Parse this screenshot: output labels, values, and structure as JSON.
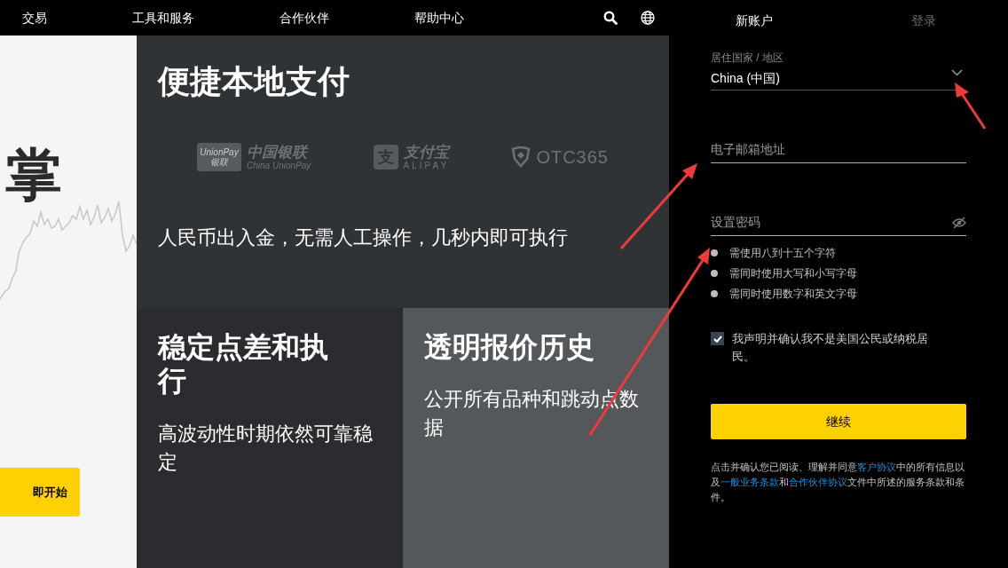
{
  "nav": {
    "items": [
      "交易",
      "工具和服务",
      "合作伙伴",
      "帮助中心"
    ]
  },
  "hero": {
    "title": "掌",
    "button": "即开始"
  },
  "cards": [
    {
      "kind": "payment",
      "title": "便捷本地支付",
      "text": "人民币出入金，无需人工操作，几秒内即可执行",
      "logos": [
        {
          "kind": "unionpay",
          "badge": "UnionPay 银联",
          "name": "中国银联",
          "sub": "China UnionPay"
        },
        {
          "kind": "alipay",
          "badge": "支",
          "name": "支付宝",
          "sub": "ALIPAY"
        },
        {
          "kind": "otc",
          "name": "OTC365"
        }
      ]
    },
    {
      "kind": "spread",
      "title": "稳定点差和执行",
      "text": "高波动性时期依然可靠稳定"
    },
    {
      "kind": "quotes",
      "title": "透明报价历史",
      "text": "公开所有品种和跳动点数据"
    }
  ],
  "signup": {
    "tabs": [
      {
        "label": "新账户",
        "selected": true
      },
      {
        "label": "登录",
        "selected": false
      }
    ],
    "country": {
      "label": "居住国家 / 地区",
      "value": "China (中国)"
    },
    "email": {
      "placeholder": "电子邮箱地址"
    },
    "password": {
      "placeholder": "设置密码"
    },
    "rules": [
      {
        "text": "需使用八到十五个字符",
        "met": false
      },
      {
        "text": "需同时使用大写和小写字母",
        "met": false
      },
      {
        "text": "需同时使用数字和英文字母",
        "met": false
      }
    ],
    "declaration": {
      "text": "我声明并确认我不是美国公民或纳税居民。",
      "checked": true
    },
    "button": "继续",
    "notice": [
      {
        "text": "点击并确认您已阅读、理解并同意",
        "link": false
      },
      {
        "text": "客户协议",
        "link": true
      },
      {
        "text": "中的所有信息以及",
        "link": false
      },
      {
        "text": "一般业务条款",
        "link": true
      },
      {
        "text": "和",
        "link": false
      },
      {
        "text": "合作伙伴协议",
        "link": true
      },
      {
        "text": "文件中所述的服务条款和条件。",
        "link": false
      }
    ]
  }
}
